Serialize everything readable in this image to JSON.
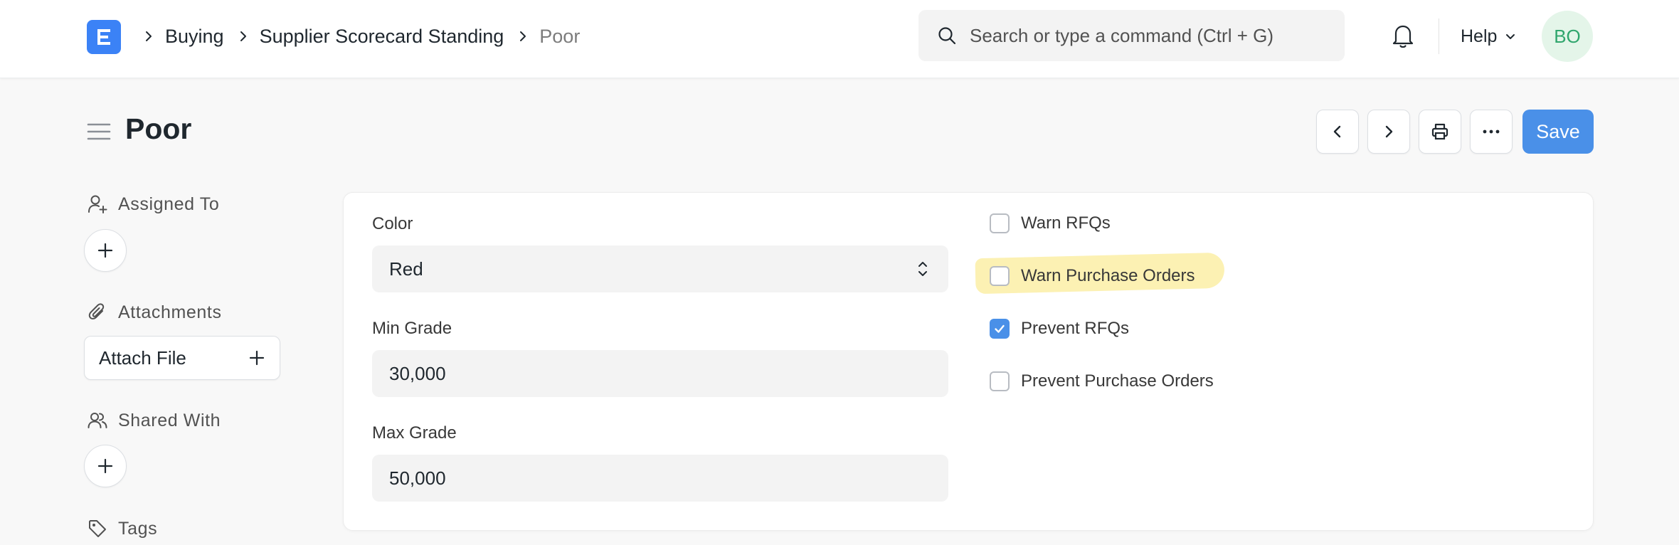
{
  "breadcrumb": [
    "Buying",
    "Supplier Scorecard Standing",
    "Poor"
  ],
  "search": {
    "placeholder": "Search or type a command (Ctrl + G)"
  },
  "help_label": "Help",
  "avatar_initials": "BO",
  "page": {
    "title": "Poor",
    "save_label": "Save"
  },
  "sidebar": {
    "assigned_to": "Assigned To",
    "attachments": "Attachments",
    "attach_file": "Attach File",
    "shared_with": "Shared With",
    "tags": "Tags"
  },
  "form": {
    "color": {
      "label": "Color",
      "value": "Red"
    },
    "min_grade": {
      "label": "Min Grade",
      "value": "30,000"
    },
    "max_grade": {
      "label": "Max Grade",
      "value": "50,000"
    },
    "checks": [
      {
        "label": "Warn RFQs",
        "checked": false
      },
      {
        "label": "Warn Purchase Orders",
        "checked": false
      },
      {
        "label": "Prevent RFQs",
        "checked": true
      },
      {
        "label": "Prevent Purchase Orders",
        "checked": false
      }
    ]
  },
  "colors": {
    "accent": "#4a90e8",
    "logo": "#3b82f6",
    "avatar_bg": "#e4f5e9",
    "avatar_text": "#30a66d",
    "highlight": "#fbeea0"
  }
}
